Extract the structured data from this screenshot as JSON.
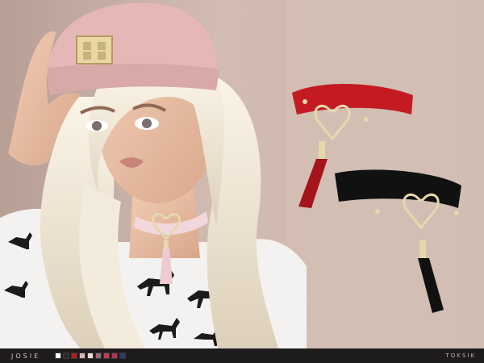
{
  "footer": {
    "collection_title": "JOSIE",
    "brand": "TOKSIK"
  },
  "swatches": [
    "#ffffff",
    "#2a2a2a",
    "#b21e28",
    "#d9b2b8",
    "#f1d4d8",
    "#9a6a78",
    "#c43b4f",
    "#b33359",
    "#2e3c66"
  ],
  "colors": {
    "background": "#cdb7ad",
    "hat": "#e5b7b7",
    "hair": "#efe6d6",
    "choker_pink": "#f2d7dc",
    "choker_red": "#c41b23",
    "choker_black": "#111111",
    "gold": "#e5d8ab"
  }
}
